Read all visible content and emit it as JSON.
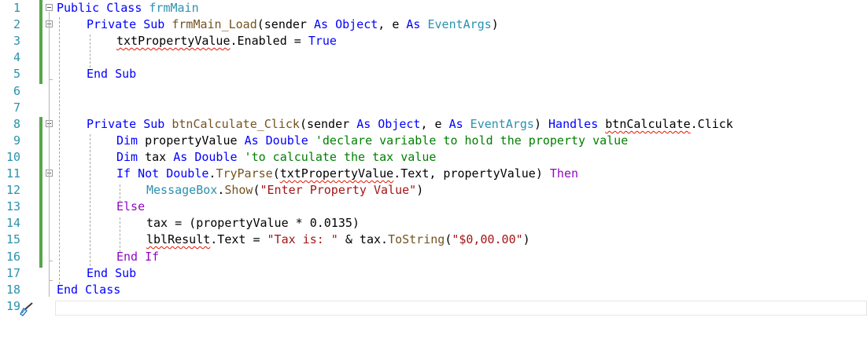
{
  "editor": {
    "line_numbers": [
      "1",
      "2",
      "3",
      "4",
      "5",
      "6",
      "7",
      "8",
      "9",
      "10",
      "11",
      "12",
      "13",
      "14",
      "15",
      "16",
      "17",
      "18",
      "19"
    ],
    "lines": {
      "l1": {
        "kw1": "Public",
        "kw2": " Class ",
        "name": "frmMain"
      },
      "l2": {
        "kw1": "Private",
        "kw2": " Sub ",
        "name": "frmMain_Load",
        "p1": "(sender ",
        "as1": "As",
        "t1": " Object",
        "p2": ", e ",
        "as2": "As",
        "t2": " EventArgs",
        "p3": ")"
      },
      "l3": {
        "ident": "txtPropertyValue",
        "rest": ".Enabled = ",
        "val": "True"
      },
      "l5": {
        "kw": "End Sub"
      },
      "l8": {
        "kw1": "Private",
        "kw2": " Sub ",
        "name": "btnCalculate_Click",
        "p1": "(sender ",
        "as1": "As",
        "t1": " Object",
        "p2": ", e ",
        "as2": "As",
        "t2": " EventArgs",
        "p3": ") ",
        "handles": "Handles",
        "sp": " ",
        "ident": "btnCalculate",
        "rest": ".Click"
      },
      "l9": {
        "kw": "Dim",
        "v": " propertyValue ",
        "as": "As",
        "t": " Double",
        "c": " 'declare variable to hold the property value"
      },
      "l10": {
        "kw": "Dim",
        "v": " tax ",
        "as": "As",
        "t": " Double",
        "c": " 'to calculate the tax value"
      },
      "l11": {
        "kw1": "If",
        "kw2": " Not ",
        "t": "Double",
        "dot": ".",
        "fn": "TryParse",
        "p1": "(",
        "ident": "txtPropertyValue",
        "p2": ".Text, propertyValue) ",
        "then": "Then"
      },
      "l12": {
        "obj": "MessageBox",
        "dot": ".",
        "fn": "Show",
        "p1": "(",
        "str": "\"Enter Property Value\"",
        "p2": ")"
      },
      "l13": {
        "kw": "Else"
      },
      "l14": {
        "text": "tax = (propertyValue * 0.0135)"
      },
      "l15": {
        "ident": "lblResult",
        "p1": ".Text = ",
        "str1": "\"Tax is: \"",
        "p2": " & tax.",
        "fn": "ToString",
        "p3": "(",
        "str2": "\"$0,00.00\"",
        "p4": ")"
      },
      "l16": {
        "kw": "End If"
      },
      "l17": {
        "kw": "End Sub"
      },
      "l18": {
        "kw": "End Class"
      }
    }
  }
}
